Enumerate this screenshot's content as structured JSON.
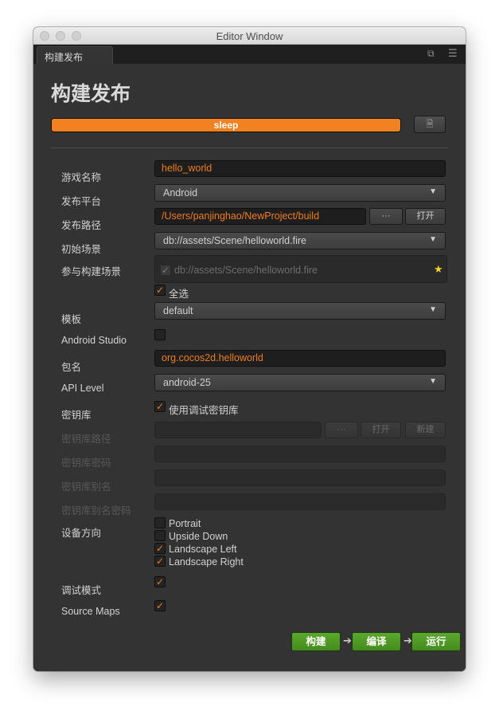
{
  "window": {
    "title": "Editor Window"
  },
  "tab": {
    "label": "构建发布"
  },
  "header": {
    "title": "构建发布"
  },
  "progress": {
    "label": "sleep",
    "percent": 100
  },
  "fields": {
    "game_name": {
      "label": "游戏名称",
      "value": "hello_world"
    },
    "platform": {
      "label": "发布平台",
      "value": "Android"
    },
    "build_path": {
      "label": "发布路径",
      "value": "/Users/panjinghao/NewProject/build",
      "browse": "···",
      "open": "打开"
    },
    "start_scene": {
      "label": "初始场景",
      "value": "db://assets/Scene/helloworld.fire"
    },
    "included_scenes": {
      "label": "参与构建场景",
      "items": [
        "db://assets/Scene/helloworld.fire"
      ],
      "select_all": "全选"
    },
    "template": {
      "label": "模板",
      "value": "default"
    },
    "android_studio": {
      "label": "Android Studio"
    },
    "package_name": {
      "label": "包名",
      "value": "org.cocos2d.helloworld"
    },
    "api_level": {
      "label": "API Level",
      "value": "android-25"
    },
    "keystore": {
      "label": "密钥库",
      "checkbox": "使用调试密钥库"
    },
    "keystore_path": {
      "label": "密钥库路径",
      "browse": "···",
      "open": "打开",
      "new": "新建"
    },
    "keystore_password": {
      "label": "密钥库密码"
    },
    "keystore_alias": {
      "label": "密钥库别名"
    },
    "keystore_alias_password": {
      "label": "密钥库别名密码"
    },
    "orientation": {
      "label": "设备方向",
      "options": [
        "Portrait",
        "Upside Down",
        "Landscape Left",
        "Landscape Right"
      ]
    },
    "debug_mode": {
      "label": "调试模式"
    },
    "source_maps": {
      "label": "Source Maps"
    }
  },
  "actions": {
    "build": "构建",
    "compile": "编译",
    "run": "运行"
  },
  "colors": {
    "accent": "#f07c1e",
    "green": "#4f9a26",
    "panel": "#333333"
  }
}
